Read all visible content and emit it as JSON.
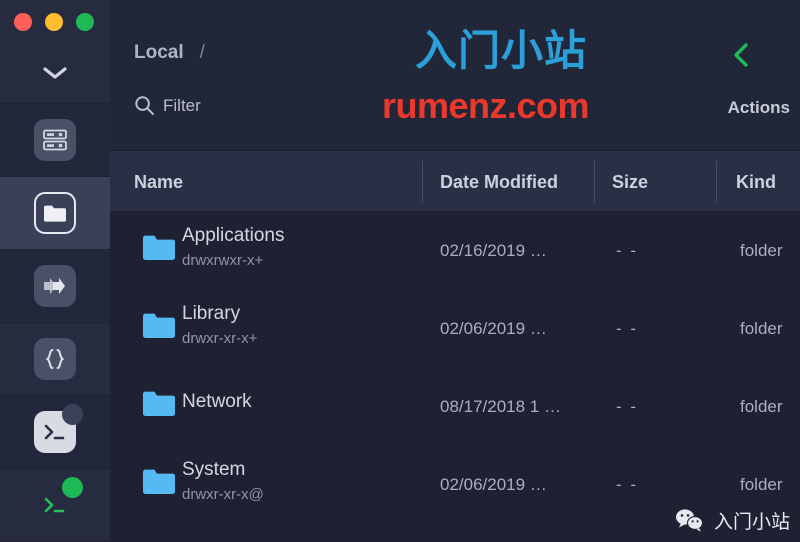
{
  "window": {
    "traffic_lights": [
      {
        "name": "close",
        "color": "#ff5f57"
      },
      {
        "name": "minimize",
        "color": "#febc2e"
      },
      {
        "name": "zoom",
        "color": "#1db954"
      }
    ]
  },
  "sidebar": {
    "collapse_icon": "chevron-down-icon",
    "items": [
      {
        "id": "servers",
        "icon": "server-rack-icon",
        "label": "Servers",
        "active": false
      },
      {
        "id": "files",
        "icon": "folder-icon",
        "label": "Files",
        "active": true
      },
      {
        "id": "transfers",
        "icon": "transfer-arrow-icon",
        "label": "Transfers",
        "active": false
      },
      {
        "id": "code",
        "icon": "braces-icon",
        "label": "Code",
        "active": false
      },
      {
        "id": "terminal-light",
        "icon": "terminal-icon",
        "label": "Terminal",
        "active": false,
        "badge": "grey"
      },
      {
        "id": "terminal-dark",
        "icon": "terminal-icon",
        "label": "Terminal Session",
        "active": false,
        "badge": "green"
      }
    ]
  },
  "header": {
    "breadcrumb": {
      "root": "Local",
      "separator": "/"
    },
    "filter": {
      "icon": "search-icon",
      "placeholder": "Filter",
      "value": ""
    },
    "back_icon": "chevron-left-icon",
    "actions_label": "Actions"
  },
  "watermark": {
    "title_cn": "入门小站",
    "url": "rumenz.com",
    "title_color": "#2b9fd8",
    "url_color": "#e8392c",
    "footer_icon": "wechat-icon",
    "footer_text": "入门小站"
  },
  "table": {
    "columns": [
      {
        "key": "name",
        "label": "Name"
      },
      {
        "key": "date",
        "label": "Date Modified"
      },
      {
        "key": "size",
        "label": "Size"
      },
      {
        "key": "kind",
        "label": "Kind"
      }
    ],
    "rows": [
      {
        "icon": "folder-icon",
        "name": "Applications",
        "permissions": "drwxrwxr-x+",
        "date": "02/16/2019",
        "date_truncated": "…",
        "size": "- -",
        "kind": "folder"
      },
      {
        "icon": "folder-icon",
        "name": "Library",
        "permissions": "drwxr-xr-x+",
        "date": "02/06/2019",
        "date_truncated": "…",
        "size": "- -",
        "kind": "folder"
      },
      {
        "icon": "folder-icon",
        "name": "Network",
        "permissions": "",
        "date": "08/17/2018 1",
        "date_truncated": "…",
        "size": "- -",
        "kind": "folder"
      },
      {
        "icon": "folder-icon",
        "name": "System",
        "permissions": "drwxr-xr-x@",
        "date": "02/06/2019",
        "date_truncated": "…",
        "size": "- -",
        "kind": "folder"
      }
    ]
  },
  "theme": {
    "sidebar_bg": "#262b40",
    "main_bg": "#222639",
    "list_bg": "#1d2132",
    "header_bg": "#2a2f45",
    "folder_color": "#55b9f3",
    "accent_green": "#1db954"
  }
}
